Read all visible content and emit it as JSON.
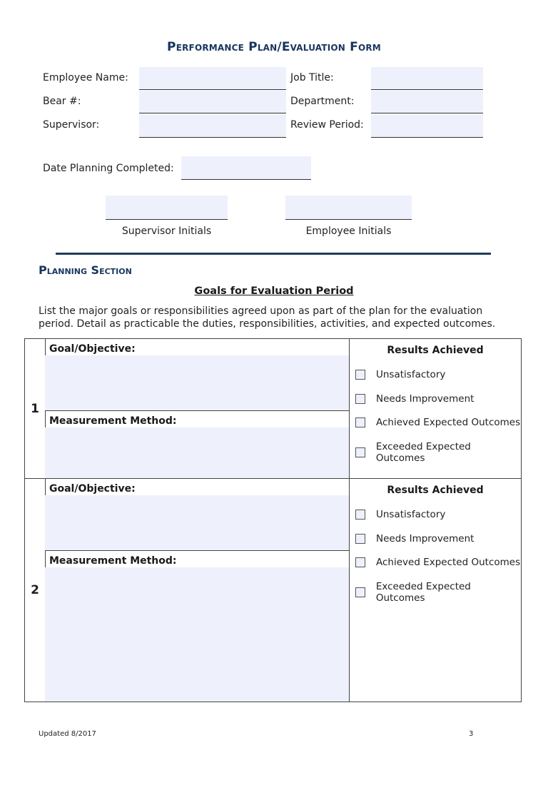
{
  "title": "Performance Plan/Evaluation Form",
  "header_fields": {
    "employee_name": {
      "label": "Employee Name:",
      "value": ""
    },
    "bear_number": {
      "label": "Bear #:",
      "value": ""
    },
    "supervisor": {
      "label": "Supervisor:",
      "value": ""
    },
    "job_title": {
      "label": "Job Title:",
      "value": ""
    },
    "department": {
      "label": "Department:",
      "value": ""
    },
    "review_period": {
      "label": "Review Period:",
      "value": ""
    },
    "date_planning_completed": {
      "label": "Date Planning Completed:",
      "value": ""
    }
  },
  "initials": {
    "supervisor": {
      "label": "Supervisor Initials",
      "value": ""
    },
    "employee": {
      "label": "Employee Initials",
      "value": ""
    }
  },
  "planning_section": {
    "title": "Planning Section",
    "goals_title": "Goals for Evaluation Period",
    "intro": "List the major goals or responsibilities agreed upon as part of the plan for the evaluation period. Detail as practicable the duties, responsibilities, activities, and expected outcomes."
  },
  "goals": [
    {
      "number": "1",
      "goal_label": "Goal/Objective:",
      "goal_value": "",
      "measurement_label": "Measurement Method:",
      "measurement_value": "",
      "results_title": "Results Achieved",
      "options": [
        {
          "label": "Unsatisfactory",
          "checked": false
        },
        {
          "label": "Needs Improvement",
          "checked": false
        },
        {
          "label": "Achieved Expected Outcomes",
          "checked": false
        },
        {
          "label": "Exceeded Expected Outcomes",
          "checked": false
        }
      ]
    },
    {
      "number": "2",
      "goal_label": "Goal/Objective:",
      "goal_value": "",
      "measurement_label": "Measurement Method:",
      "measurement_value": "",
      "results_title": "Results Achieved",
      "options": [
        {
          "label": "Unsatisfactory",
          "checked": false
        },
        {
          "label": "Needs Improvement",
          "checked": false
        },
        {
          "label": "Achieved Expected Outcomes",
          "checked": false
        },
        {
          "label": "Exceeded Expected Outcomes",
          "checked": false
        }
      ]
    }
  ],
  "footer": {
    "updated": "Updated 8/2017",
    "page_number": "3"
  },
  "colors": {
    "heading_navy": "#17365d",
    "field_fill": "#eef1fc",
    "divider": "#1f3a5c"
  }
}
